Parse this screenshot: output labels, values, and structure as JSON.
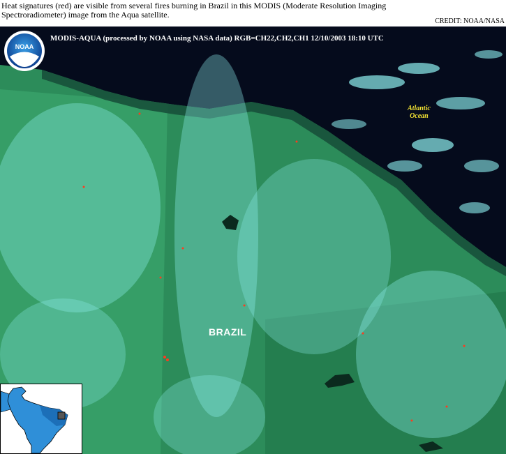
{
  "caption": {
    "text": "Heat signatures (red) are visible from several fires burning in Brazil in this MODIS (Moderate Resolution Imaging Spectroradiometer) image from the Aqua satellite.",
    "credit": "CREDIT: NOAA/NASA"
  },
  "image": {
    "header": "MODIS-AQUA  (processed by NOAA using NASA data)  RGB=CH22,CH2,CH1  12/10/2003  18:10 UTC",
    "logo_text": "NOAA",
    "ocean_label_line1": "Atlantic",
    "ocean_label_line2": "Ocean",
    "country_label": "BRAZIL"
  },
  "colors": {
    "land": "#2a8a58",
    "ocean": "#050b1c",
    "cloud": "#8ef0f0",
    "fire": "#ff3a1e",
    "inset_highlight": "#2f8fd8"
  }
}
